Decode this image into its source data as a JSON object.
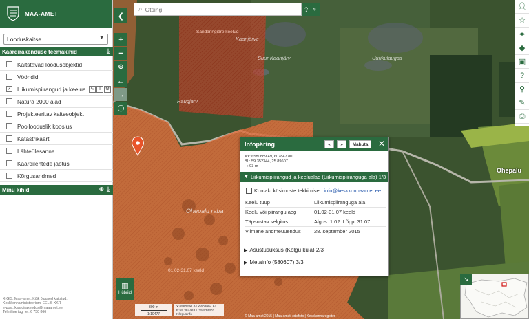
{
  "app": {
    "brand": "MAA-AMET"
  },
  "sidebar": {
    "layer_select": "Looduskaitse",
    "theme_header": "Kaardirakenduse teemakihid",
    "theme_items": [
      {
        "label": "Kaitstavad loodusobjektid",
        "checked": false
      },
      {
        "label": "Vööndid",
        "checked": false
      },
      {
        "label": "Liikumispiirangud ja keelua...",
        "checked": true
      },
      {
        "label": "Natura 2000 alad",
        "checked": false
      },
      {
        "label": "Projekteeritav kaitseobjekt",
        "checked": false
      },
      {
        "label": "Poollooduslik kooslus",
        "checked": false
      },
      {
        "label": "Katastrikaart",
        "checked": false
      },
      {
        "label": "Lähteülesanne",
        "checked": false
      },
      {
        "label": "Kaardilehtede jaotus",
        "checked": false
      },
      {
        "label": "Kõrgusandmed",
        "checked": false
      }
    ],
    "my_layers_header": "Minu kihid",
    "footer": [
      "X-GIS. Maa-amet. Kõik õigused kaitstud.",
      "Keskkonnaministeeriumi EELIS XKR",
      "e-post: kaardirakendus@maaamet.ee",
      "Tehniline tugi tel: 6 750 866"
    ]
  },
  "search": {
    "placeholder": "Otsing",
    "help": "?",
    "expand": "»"
  },
  "map": {
    "labels": {
      "kaanjarve": "Kaanjärve",
      "suur_kaanjarv": "Suur Kaanjärv",
      "uurikulaugas": "Uurikulaugas",
      "haugjarv": "Haugjärv",
      "ohepalu_raba": "Ohepalu raba",
      "zone_red": "Sandaringiäre keelud",
      "zone_orange": "01.02-31.07 keeld",
      "ohepalu": "Ohepalu"
    },
    "scale": {
      "distance": "300 m",
      "ratio": "1:10477"
    },
    "coords": {
      "x": "X:6580290.44 Y:609994.64",
      "b": "B:59.384463 L:25.934303",
      "k": "Kõrgusinfo"
    },
    "attribution": "© Maa-amet 2015 | Maa-ameti ortofoto | Keskkonnaregister",
    "hybrid": "Hübriid"
  },
  "info_popup": {
    "title": "Infopäring",
    "prev": "«",
    "next": "»",
    "print": "Mahuta",
    "close": "✕",
    "coords": [
      "XY: 6580889.49, 607847.80",
      "BL: 59.352344, 25.89607",
      "H: 93 m"
    ],
    "section_open": "Liikumispiirangud ja keelualad (Liikumispiiranguga ala) 1/3",
    "contact_text": "Kontakt küsimuste tekkimisel:",
    "contact_email": "info@keskkonnaamet.ee",
    "rows": [
      {
        "key": "Keelu tüüp",
        "value": "Liikumispiiranguga ala"
      },
      {
        "key": "Keelu või piirangu aeg",
        "value": "01.02-31.07 keeld"
      },
      {
        "key": "Täpsustav selgitus",
        "value": "Algus: 1.02. Lõpp: 31.07."
      },
      {
        "key": "Viimane andmeuuendus",
        "value": "28. september 2015"
      }
    ],
    "section_2": "Asustusüksus (Kolgu küla) 2/3",
    "section_3": "Metainfo (580607) 3/3"
  }
}
